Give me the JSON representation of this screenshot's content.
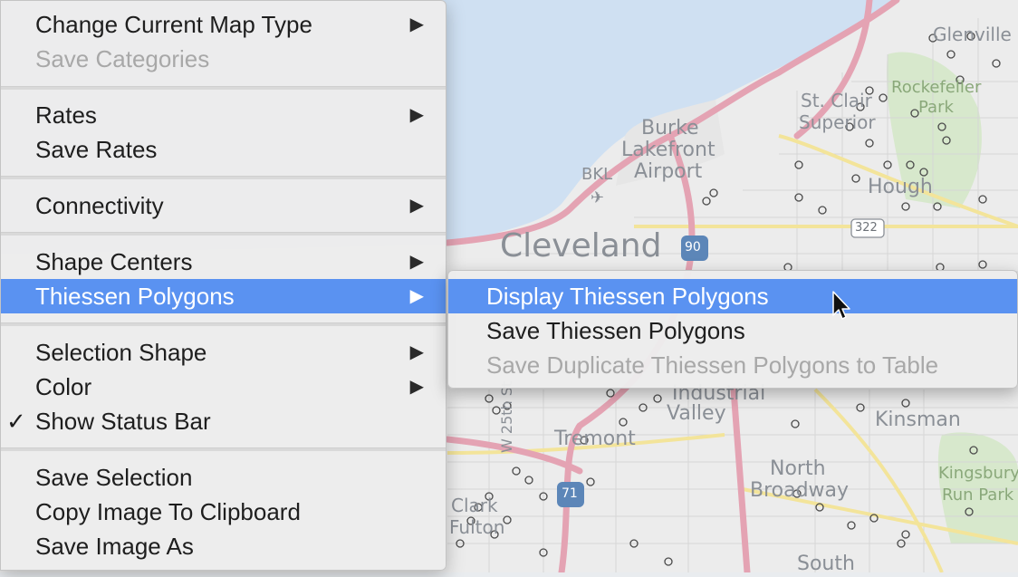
{
  "main_menu": {
    "items": [
      {
        "label": "Change Current Map Type",
        "has_submenu": true,
        "enabled": true
      },
      {
        "label": "Save Categories",
        "has_submenu": false,
        "enabled": false
      },
      {
        "label": "Rates",
        "has_submenu": true,
        "enabled": true
      },
      {
        "label": "Save Rates",
        "has_submenu": false,
        "enabled": true
      },
      {
        "label": "Connectivity",
        "has_submenu": true,
        "enabled": true
      },
      {
        "label": "Shape Centers",
        "has_submenu": true,
        "enabled": true
      },
      {
        "label": "Thiessen Polygons",
        "has_submenu": true,
        "enabled": true,
        "highlighted": true
      },
      {
        "label": "Selection Shape",
        "has_submenu": true,
        "enabled": true
      },
      {
        "label": "Color",
        "has_submenu": true,
        "enabled": true
      },
      {
        "label": "Show Status Bar",
        "has_submenu": false,
        "enabled": true,
        "checked": true
      },
      {
        "label": "Save Selection",
        "has_submenu": false,
        "enabled": true
      },
      {
        "label": "Copy Image To Clipboard",
        "has_submenu": false,
        "enabled": true
      },
      {
        "label": "Save Image As",
        "has_submenu": false,
        "enabled": true
      }
    ],
    "arrow_glyph": "▶",
    "check_glyph": "✓"
  },
  "submenu": {
    "items": [
      {
        "label": "Display Thiessen Polygons",
        "enabled": true,
        "highlighted": true
      },
      {
        "label": "Save Thiessen Polygons",
        "enabled": true
      },
      {
        "label": "Save Duplicate Thiessen Polygons to Table",
        "enabled": false
      }
    ]
  },
  "map": {
    "labels": {
      "cleveland": "Cleveland",
      "burke": "Burke",
      "lakefront": "Lakefront",
      "airport": "Airport",
      "bkl": "BKL",
      "glenville": "Glenville",
      "st_clair": "St. Clair",
      "superior": "Superior",
      "rockefeller": "Rockefeller",
      "park": "Park",
      "hough": "Hough",
      "industrial": "Industrial",
      "valley": "Valley",
      "tremont": "Tremont",
      "kinsman": "Kinsman",
      "north": "North",
      "broadway": "Broadway",
      "kingsbury": "Kingsbury",
      "run_park": "Run Park",
      "clark": "Clark",
      "fulton": "Fulton",
      "w25th": "W 25th St",
      "south": "South",
      "shield_90": "90",
      "shield_71": "71",
      "shield_322": "322"
    },
    "colors": {
      "water": "#cfe0f2",
      "land": "#ececec",
      "highway": "#e4a3b3",
      "road_yellow": "#f3e49a",
      "park": "#cfe3c0",
      "poi_ring": "#4a4a4a"
    }
  },
  "theme": {
    "highlight": "#5a92f1",
    "disabled_text": "#a8a8a8"
  }
}
